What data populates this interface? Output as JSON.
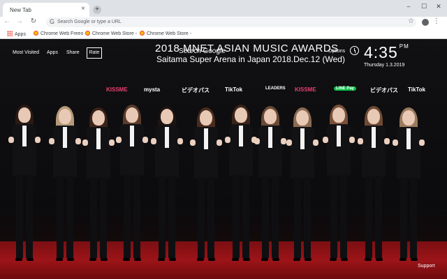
{
  "browser": {
    "tab_title": "New Tab",
    "tab_close": "×",
    "new_tab": "+",
    "minimize": "–",
    "maximize": "☐",
    "close": "✕",
    "back": "←",
    "forward": "→",
    "reload": "↻",
    "omnibox_placeholder": "Search Google or type a URL",
    "star": "☆",
    "menu": "⋮"
  },
  "bookmarks": {
    "items": [
      {
        "label": "Apps",
        "icon": "apps-icon"
      },
      {
        "label": "Chrome Web Freeo",
        "icon": "favicon"
      },
      {
        "label": "Chrome Web Store -",
        "icon": "favicon"
      },
      {
        "label": "Chrome Web Store -",
        "icon": "favicon"
      }
    ]
  },
  "overlay": {
    "most_visited": "Most Visited",
    "apps": "Apps",
    "share": "Share",
    "rate": "Rate",
    "search_google": "Search Google",
    "options": "Options",
    "time": "4:35",
    "am_pm": "PM",
    "date": "Thursday  1.3.2019",
    "support": "Support"
  },
  "backdrop_text": {
    "headline": "2018 MNET ASIAN MUSIC AWARDS",
    "subline": "Saitama Super Arena in Japan  2018.Dec.12 (Wed)",
    "sponsors": [
      "KISSME",
      "mysta",
      "ビデオパス",
      "TikTok",
      "LEADERS",
      "KISSME",
      "LINE Pay",
      "ビデオパス",
      "TikTok"
    ]
  },
  "colors": {
    "chrome_frame": "#dee1e6",
    "carpet": "#9c1418",
    "overlay_text": "#ffffff"
  }
}
